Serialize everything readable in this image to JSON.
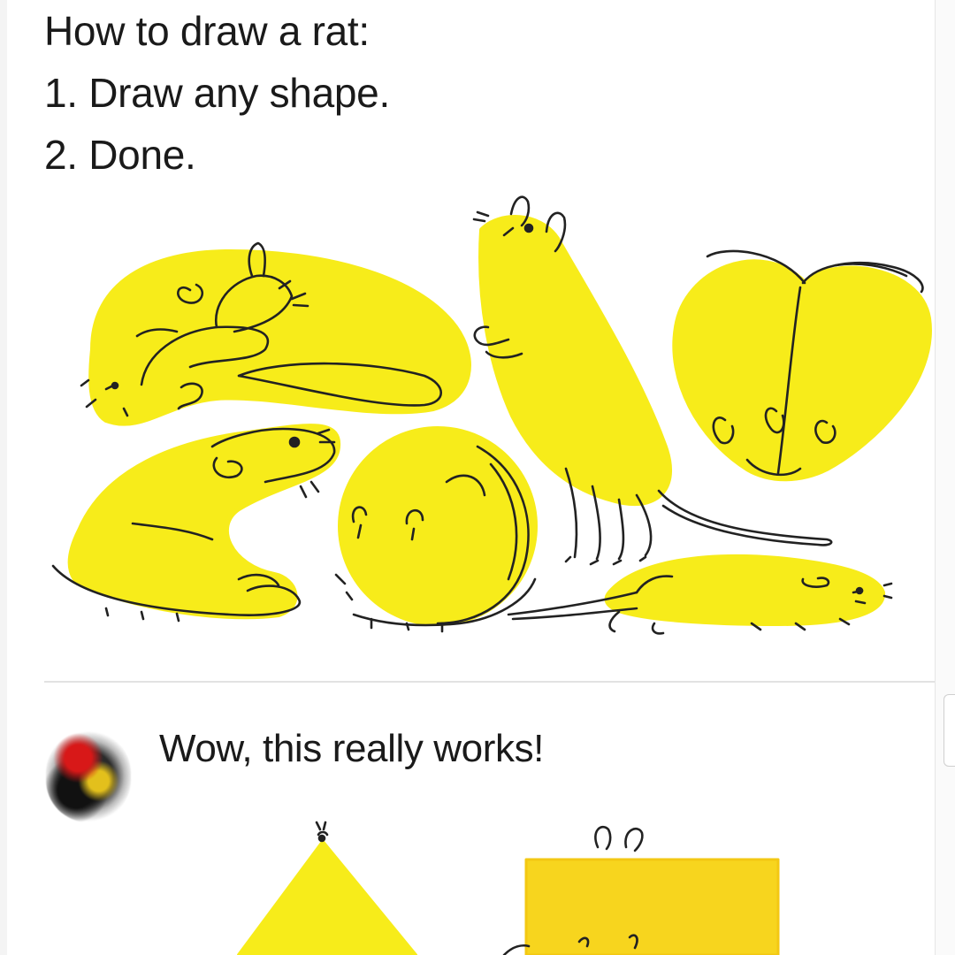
{
  "post": {
    "lines": [
      "How to draw a rat:",
      "1. Draw any shape.",
      "2. Done."
    ]
  },
  "comment": {
    "text": "Wow, this really works!"
  },
  "colors": {
    "fill": "#f7ec1a",
    "line": "#222222",
    "background": "#ffffff",
    "divider": "#e2e2e2",
    "bottom_square": "#f7d51e"
  },
  "illustrations": [
    "rat-banana-shape",
    "rat-upright-oval-shape",
    "rat-heart-shape",
    "rat-crescent-shape",
    "rat-circle-shape",
    "rat-long-flat-shape",
    "rat-triangle-shape",
    "rat-square-shape"
  ]
}
